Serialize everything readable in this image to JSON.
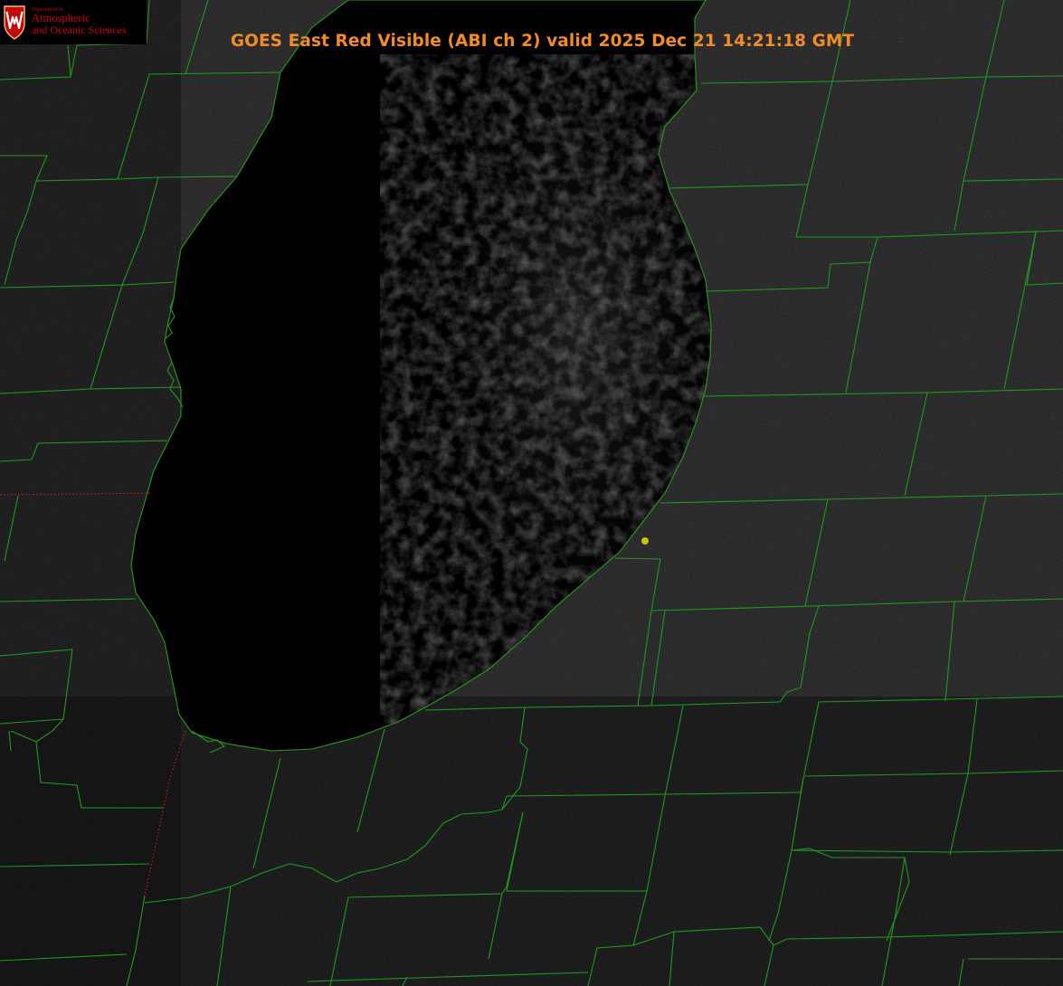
{
  "title": "GOES East Red Visible (ABI ch 2) valid 2025 Dec 21 14:21:18 GMT",
  "logo": {
    "line0": "Department of",
    "line1": "Atmospheric",
    "line2": "and Oceanic Sciences",
    "icon": "uw-crest-icon",
    "color": "#c5050c"
  },
  "colors": {
    "title": "#f28c28",
    "county_lines": "#1f9a1f",
    "state_lines": "#d81e1e",
    "lake": "#000000",
    "land": "#1c1c1c",
    "marker": "#c8c400"
  },
  "layers": [
    "county-boundaries",
    "state-boundaries",
    "lake-shoreline",
    "location-marker"
  ]
}
